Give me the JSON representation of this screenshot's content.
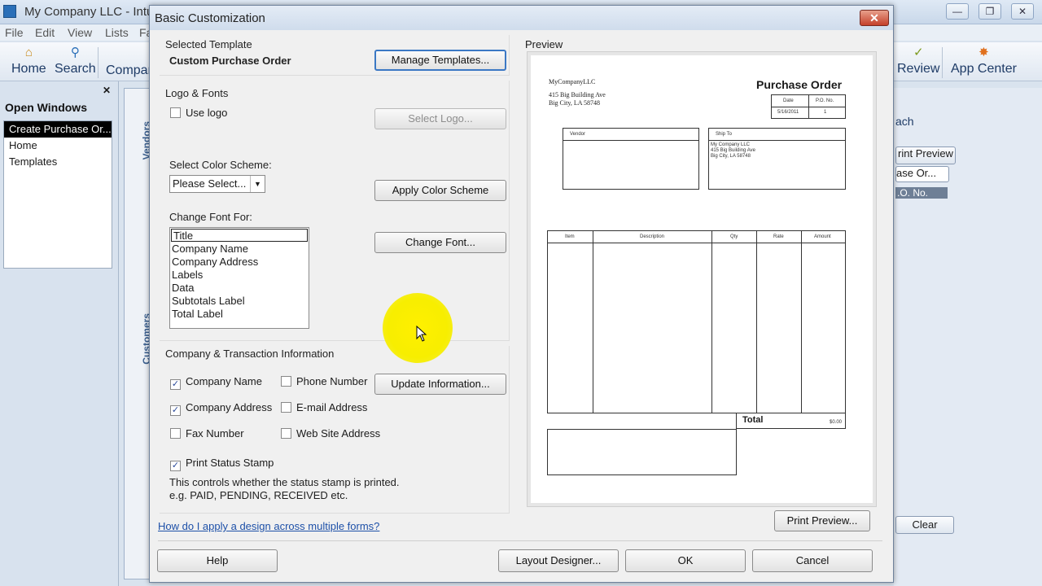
{
  "app": {
    "title": "My Company LLC  - Intu",
    "menu": [
      "File",
      "Edit",
      "View",
      "Lists",
      "Fa"
    ],
    "toolbar": [
      {
        "label": "Home",
        "icon": "house-icon"
      },
      {
        "label": "Search",
        "icon": "search-icon"
      },
      {
        "label": "Compan",
        "icon": "company-icon"
      },
      {
        "label": "Review",
        "icon": "review-icon"
      },
      {
        "label": "App Center",
        "icon": "app-center-icon"
      }
    ]
  },
  "open_windows": {
    "title": "Open Windows",
    "items": [
      "Create Purchase Or...",
      "Home",
      "Templates"
    ]
  },
  "side_tabs": {
    "vendors": "Vendors",
    "customers": "Customers"
  },
  "right_pane": {
    "search_label": "ach",
    "print_preview": "rint Preview",
    "select_value": "ase Or...",
    "col_header": ".O. No.",
    "clear": "Clear"
  },
  "dialog": {
    "title": "Basic Customization",
    "selected_template": {
      "label": "Selected Template",
      "value": "Custom Purchase Order",
      "manage_button": "Manage Templates..."
    },
    "logo_fonts": {
      "label": "Logo & Fonts",
      "use_logo": "Use logo",
      "use_logo_checked": false,
      "select_logo_button": "Select Logo..."
    },
    "color_scheme": {
      "label": "Select Color Scheme:",
      "selected": "Please Select...",
      "apply_button": "Apply Color Scheme"
    },
    "fonts": {
      "label": "Change Font For:",
      "items": [
        "Title",
        "Company Name",
        "Company Address",
        "Labels",
        "Data",
        "Subtotals Label",
        "Total Label"
      ],
      "change_button": "Change Font..."
    },
    "company_info": {
      "label": "Company & Transaction Information",
      "options": [
        {
          "label": "Company Name",
          "checked": true
        },
        {
          "label": "Phone Number",
          "checked": false
        },
        {
          "label": "Company Address",
          "checked": true
        },
        {
          "label": "E-mail Address",
          "checked": false
        },
        {
          "label": "Fax Number",
          "checked": false
        },
        {
          "label": "Web Site Address",
          "checked": false
        }
      ],
      "update_button": "Update Information...",
      "print_status_stamp": "Print Status Stamp",
      "print_status_checked": true,
      "note_line1": "This controls whether the status stamp is printed.",
      "note_line2": "e.g. PAID, PENDING, RECEIVED etc."
    },
    "help_link": "How do I apply a design across multiple forms?",
    "preview": {
      "label": "Preview",
      "company_name": "MyCompanyLLC",
      "address_line1": "415 Big Building Ave",
      "address_line2": "Big City, LA  58748",
      "doc_title": "Purchase Order",
      "date_header": "Date",
      "po_header": "P.O. No.",
      "date_value": "5/16/2011",
      "po_value": "1",
      "vendor_header": "Vendor",
      "ship_to_header": "Ship To",
      "ship_to_line1": "My Company LLC",
      "ship_to_line2": "415 Big Building Ave",
      "ship_to_line3": "Big City, LA  58748",
      "columns": [
        "Item",
        "Description",
        "Qty",
        "Rate",
        "Amount"
      ],
      "total_label": "Total",
      "total_value": "$0.00",
      "print_preview_button": "Print Preview..."
    },
    "buttons": {
      "help": "Help",
      "layout_designer": "Layout Designer...",
      "ok": "OK",
      "cancel": "Cancel"
    }
  }
}
